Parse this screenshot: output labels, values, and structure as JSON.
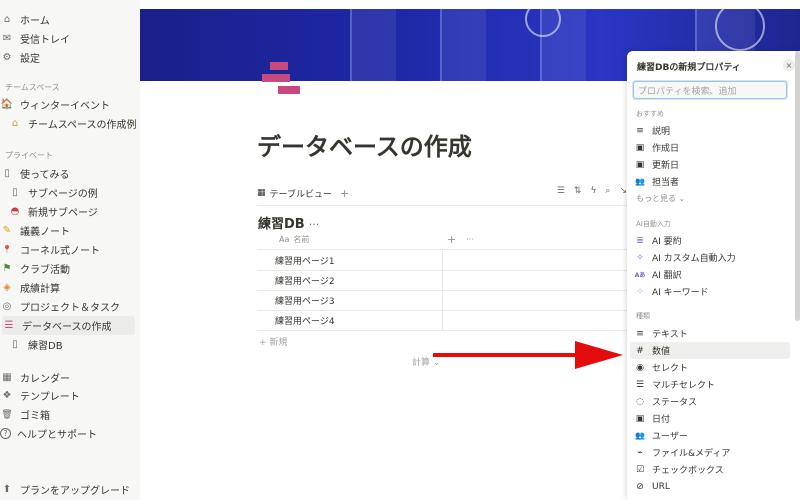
{
  "sidebar": {
    "top_items": [
      {
        "label": "ホーム",
        "icon": "home-icon",
        "glyph": "⌂"
      },
      {
        "label": "受信トレイ",
        "icon": "inbox-icon",
        "glyph": "✉"
      },
      {
        "label": "設定",
        "icon": "gear-icon",
        "glyph": "⚙"
      }
    ],
    "team_section": "チームスペース",
    "team_items": [
      {
        "label": "ウィンターイベント",
        "icon": "house-icon",
        "glyph": "🏠"
      },
      {
        "label": "チームスペースの作成例",
        "icon": "house-sub-icon",
        "glyph": "⌂"
      }
    ],
    "private_section": "プライベート",
    "private_items": [
      {
        "label": "使ってみる",
        "icon": "page-icon",
        "glyph": "▯"
      },
      {
        "label": "サブページの例",
        "icon": "page-icon",
        "glyph": "▯"
      },
      {
        "label": "新規サブページ",
        "icon": "watermelon-icon",
        "glyph": "◓"
      },
      {
        "label": "議義ノート",
        "icon": "pencil-icon",
        "glyph": "✎"
      },
      {
        "label": "コーネル式ノート",
        "icon": "pin-icon",
        "glyph": "📍"
      },
      {
        "label": "クラブ活動",
        "icon": "flag-icon",
        "glyph": "⚑"
      },
      {
        "label": "成績計算",
        "icon": "badge-icon",
        "glyph": "◈"
      },
      {
        "label": "プロジェクト＆タスク",
        "icon": "target-icon",
        "glyph": "◎"
      },
      {
        "label": "データベースの作成",
        "icon": "db-stack-icon",
        "glyph": "☰"
      },
      {
        "label": "練習DB",
        "icon": "page-icon",
        "glyph": "▯"
      }
    ],
    "bottom_items": [
      {
        "label": "カレンダー",
        "icon": "calendar-icon",
        "glyph": "▦"
      },
      {
        "label": "テンプレート",
        "icon": "template-icon",
        "glyph": "❖"
      },
      {
        "label": "ゴミ箱",
        "icon": "trash-icon",
        "glyph": "🗑"
      },
      {
        "label": "ヘルプとサポート",
        "icon": "help-icon",
        "glyph": "?"
      }
    ],
    "upgrade_label": "プランをアップグレード"
  },
  "main": {
    "title": "データベースの作成",
    "view_tab": "テーブルビュー",
    "add_view": "+",
    "db_title": "練習DB",
    "db_more": "···",
    "column_name": "名前",
    "column_prefix": "Aa",
    "column_add": "+",
    "column_more": "···",
    "rows": [
      "練習用ページ1",
      "練習用ページ2",
      "練習用ページ3",
      "練習用ページ4"
    ],
    "new_row": "+ 新規",
    "calc": "計算 ⌄"
  },
  "panel": {
    "title": "練習DBの新規プロパティ",
    "close": "×",
    "search_placeholder": "プロパティを検索、追加",
    "recommended": "おすすめ",
    "recommended_items": [
      {
        "label": "説明",
        "icon": "text-lines-icon",
        "glyph": "≡"
      },
      {
        "label": "作成日",
        "icon": "calendar-icon",
        "glyph": "▣"
      },
      {
        "label": "更新日",
        "icon": "calendar-icon",
        "glyph": "▣"
      },
      {
        "label": "担当者",
        "icon": "people-icon",
        "glyph": "👥"
      }
    ],
    "show_more": "もっと見る ⌄",
    "ai_section": "AI自動入力",
    "ai_items": [
      {
        "label": "AI 要約",
        "icon": "ai-summary-icon",
        "glyph": "≣"
      },
      {
        "label": "AI カスタム自動入力",
        "icon": "sparkle-icon",
        "glyph": "✧"
      },
      {
        "label": "AI 翻訳",
        "icon": "translate-icon",
        "glyph": "Aあ"
      },
      {
        "label": "AI キーワード",
        "icon": "keyword-icon",
        "glyph": "⁘"
      }
    ],
    "type_section": "種類",
    "type_items": [
      {
        "label": "テキスト",
        "icon": "text-lines-icon",
        "glyph": "≡"
      },
      {
        "label": "数値",
        "icon": "hash-icon",
        "glyph": "#"
      },
      {
        "label": "セレクト",
        "icon": "select-icon",
        "glyph": "◉"
      },
      {
        "label": "マルチセレクト",
        "icon": "list-icon",
        "glyph": "☰"
      },
      {
        "label": "ステータス",
        "icon": "status-icon",
        "glyph": "◌"
      },
      {
        "label": "日付",
        "icon": "date-icon",
        "glyph": "▣"
      },
      {
        "label": "ユーザー",
        "icon": "people-icon",
        "glyph": "👥"
      },
      {
        "label": "ファイル&メディア",
        "icon": "paperclip-icon",
        "glyph": "⌁"
      },
      {
        "label": "チェックボックス",
        "icon": "checkbox-icon",
        "glyph": "☑"
      },
      {
        "label": "URL",
        "icon": "link-icon",
        "glyph": "⊘"
      }
    ]
  },
  "colors": {
    "accent_red": "#e40c0c",
    "page_icon": "#c8497f",
    "cover_blue": "#1e29a8"
  }
}
